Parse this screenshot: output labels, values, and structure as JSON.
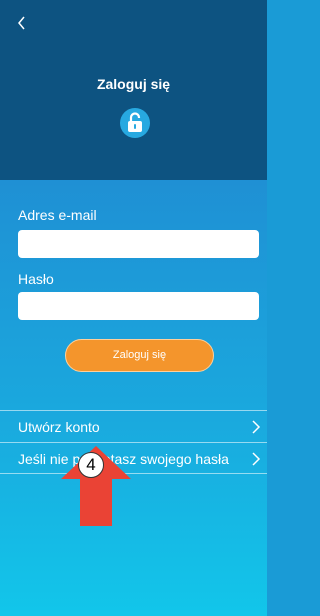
{
  "header": {
    "title": "Zaloguj się",
    "background": "#0d5381",
    "back_icon": "chevron-left-icon",
    "lock_icon": "unlock-icon"
  },
  "form": {
    "email_label": "Adres e-mail",
    "email_value": "",
    "password_label": "Hasło",
    "password_value": "",
    "login_button": "Zaloguj się"
  },
  "links": [
    {
      "label": "Utwórz konto",
      "icon": "chevron-right-icon"
    },
    {
      "label": "Jeśli nie pamiętasz swojego hasła",
      "icon": "chevron-right-icon"
    }
  ],
  "annotation": {
    "number": "4",
    "arrow_color": "#ea4335"
  },
  "colors": {
    "accent": "#f4952c",
    "body_top": "#1f90d4",
    "body_bottom": "#12c6ea"
  }
}
